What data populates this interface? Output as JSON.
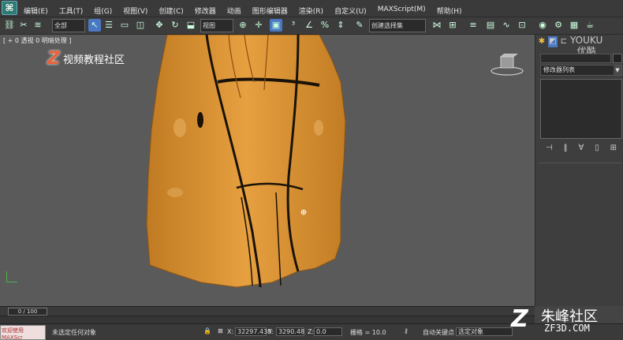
{
  "titlebar": {
    "menus": [
      "编辑(E)",
      "工具(T)",
      "组(G)",
      "视图(V)",
      "创建(C)",
      "修改器",
      "动画",
      "图形编辑器",
      "渲染(R)",
      "自定义(U)",
      "MAXScript(M)",
      "帮助(H)"
    ]
  },
  "toolbar": {
    "selection_filter": "全部",
    "ref_coord": "视图",
    "named_selection": "创建选择集"
  },
  "viewport": {
    "label": "[ + 0 透视 0 明暗处理 ]",
    "watermark_text": "视频教程社区",
    "subject": "orange-textured-mesh"
  },
  "command_panel": {
    "brand": "YOUKU\n优酷",
    "modifier_list": "修改器列表"
  },
  "time_slider": {
    "frame_readout": "0 / 100"
  },
  "status": {
    "selection_msg": "未选定任何对象",
    "x_label": "X:",
    "x_value": "32297.438",
    "y_label": "Y:",
    "y_value": "3290.48",
    "z_label": "Z:",
    "z_value": "0.0",
    "grid": "栅格 = 10.0",
    "auto_key": "自动关键点",
    "key_filter": "选定对象",
    "script_box": "欢迎使用 MAXScr"
  },
  "corner_watermark": {
    "name": "朱峰社区",
    "site": "ZF3D.COM"
  },
  "colors": {
    "viewport_bg": "#5a5a5a",
    "model_orange": "#d8922e",
    "accent_blue": "#4a78c2"
  }
}
